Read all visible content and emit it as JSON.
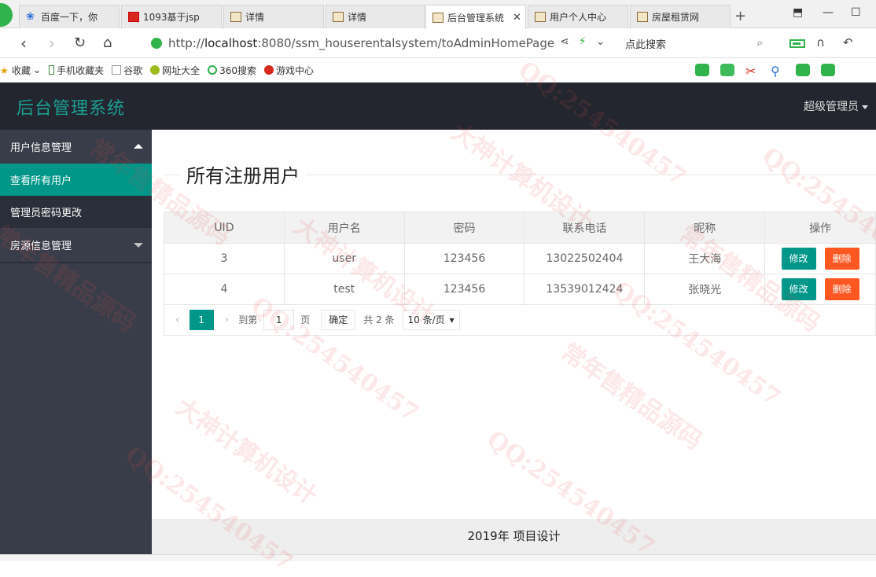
{
  "browser": {
    "tabs": [
      {
        "label": "百度一下，你",
        "icon": "paw"
      },
      {
        "label": "1093基于jsp",
        "icon": "red"
      },
      {
        "label": "详情",
        "icon": "page"
      },
      {
        "label": "详情",
        "icon": "page"
      },
      {
        "label": "后台管理系统",
        "icon": "page",
        "active": true
      },
      {
        "label": "用户个人中心",
        "icon": "page"
      },
      {
        "label": "房屋租赁网",
        "icon": "page"
      }
    ],
    "url_prefix": "http://",
    "url_host": "localhost",
    "url_rest": ":8080/ssm_houserentalsystem/toAdminHomePage",
    "search_placeholder": "点此搜索",
    "bookmarks": [
      "收藏",
      "手机收藏夹",
      "谷歌",
      "网址大全",
      "360搜索",
      "游戏中心"
    ]
  },
  "app": {
    "title": "后台管理系统",
    "user": "超级管理员"
  },
  "sidebar": {
    "groups": [
      {
        "label": "用户信息管理",
        "items": [
          "查看所有用户",
          "管理员密码更改"
        ]
      },
      {
        "label": "房源信息管理"
      }
    ]
  },
  "main": {
    "title": "所有注册用户",
    "columns": [
      "UID",
      "用户名",
      "密码",
      "联系电话",
      "昵称",
      "操作"
    ],
    "rows": [
      [
        "3",
        "user",
        "123456",
        "13022502404",
        "王大海"
      ],
      [
        "4",
        "test",
        "123456",
        "13539012424",
        "张晓光"
      ]
    ],
    "edit_label": "修改",
    "delete_label": "删除",
    "pager": {
      "current": "1",
      "goto_label": "到第",
      "goto_value": "1",
      "page_unit": "页",
      "confirm": "确定",
      "total": "共 2 条",
      "per_page": "10 条/页"
    }
  },
  "footer": "2019年 项目设计",
  "watermarks": [
    "大神计算机设计",
    "QQ:254540457",
    "常年售精品源码"
  ]
}
